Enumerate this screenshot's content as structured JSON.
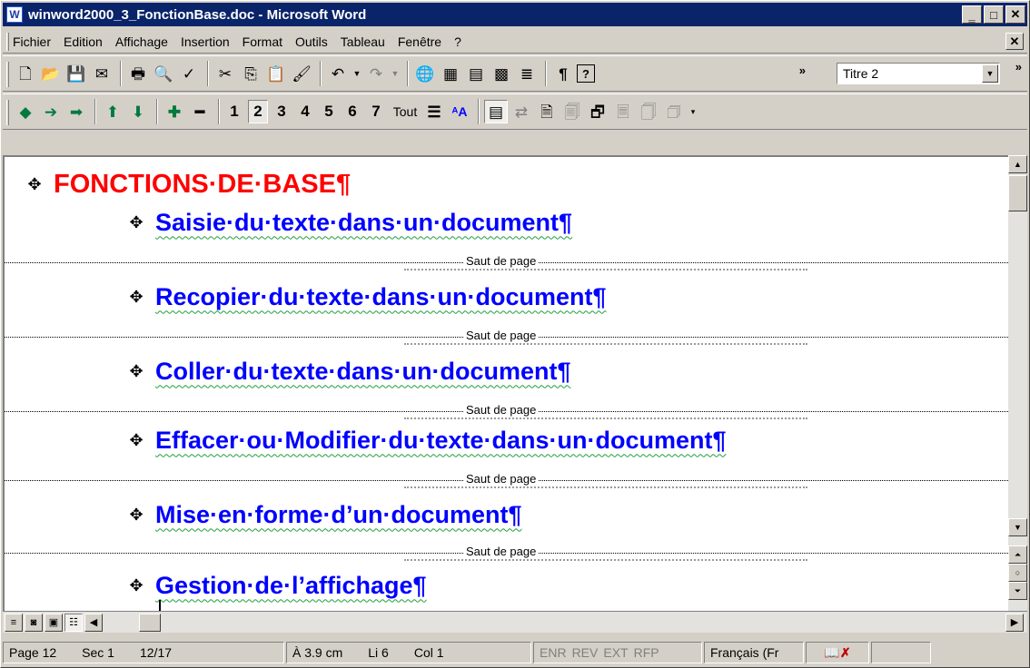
{
  "window": {
    "title": "winword2000_3_FonctionBase.doc - Microsoft Word",
    "app_icon": "word-doc-icon"
  },
  "menu": {
    "items": [
      "Fichier",
      "Edition",
      "Affichage",
      "Insertion",
      "Format",
      "Outils",
      "Tableau",
      "Fenêtre",
      "?"
    ]
  },
  "standard_toolbar": {
    "buttons": [
      {
        "name": "new-document-icon",
        "glyph": "🗋"
      },
      {
        "name": "open-folder-icon",
        "glyph": "📂"
      },
      {
        "name": "save-icon",
        "glyph": "💾"
      },
      {
        "name": "email-icon",
        "glyph": "✉"
      },
      {
        "name": "print-icon",
        "glyph": "🖶"
      },
      {
        "name": "print-preview-icon",
        "glyph": "🔍"
      },
      {
        "name": "spelling-icon",
        "glyph": "✓"
      },
      {
        "name": "cut-icon",
        "glyph": "✂"
      },
      {
        "name": "copy-icon",
        "glyph": "⎘"
      },
      {
        "name": "paste-icon",
        "glyph": "📋"
      },
      {
        "name": "format-painter-icon",
        "glyph": "🖌"
      },
      {
        "name": "undo-icon",
        "glyph": "↶"
      },
      {
        "name": "redo-icon",
        "glyph": "↷"
      },
      {
        "name": "hyperlink-icon",
        "glyph": "🌐"
      },
      {
        "name": "tables-borders-icon",
        "glyph": "▦"
      },
      {
        "name": "insert-table-icon",
        "glyph": "▤"
      },
      {
        "name": "insert-excel-icon",
        "glyph": "▩"
      },
      {
        "name": "columns-icon",
        "glyph": "≣"
      },
      {
        "name": "show-formatting-icon",
        "glyph": "¶"
      },
      {
        "name": "help-icon",
        "glyph": "?"
      }
    ],
    "style_value": "Titre 2"
  },
  "outline_toolbar": {
    "levels": [
      "1",
      "2",
      "3",
      "4",
      "5",
      "6",
      "7"
    ],
    "selected_level": "2",
    "all_label": "Tout"
  },
  "document": {
    "heading1": "FONCTIONS·DE·BASE¶",
    "headings2": [
      "Saisie·du·texte·dans·un·document¶",
      "Recopier·du·texte·dans·un·document¶",
      "Coller·du·texte·dans·un·document¶",
      "Effacer·ou·Modifier·du·texte·dans·un·document¶",
      "Mise·en·forme·d’un·document¶",
      "Gestion·de·l’affichage¶"
    ],
    "page_break_label": "Saut de page",
    "heading1_color": "#ff0000",
    "heading2_color": "#0000ff"
  },
  "status": {
    "page": "Page 12",
    "section": "Sec 1",
    "pages": "12/17",
    "at": "À 3.9 cm",
    "line": "Li 6",
    "col": "Col 1",
    "modes": [
      "ENR",
      "REV",
      "EXT",
      "RFP"
    ],
    "language": "Français (Fr"
  }
}
